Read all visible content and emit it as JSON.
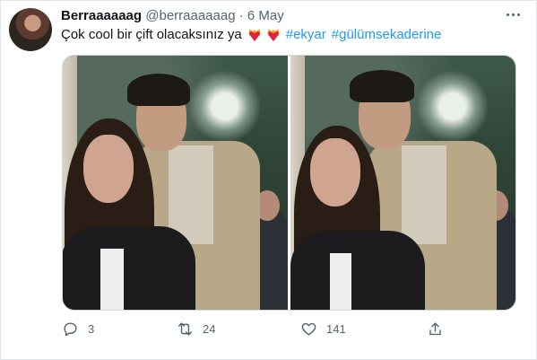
{
  "tweet": {
    "display_name": "Berraaaaaag",
    "handle": "@berraaaaaag",
    "separator": "·",
    "date": "6 May",
    "text": "Çok cool bir çift olacaksınız ya",
    "emoji_icon": "heart-on-fire-icon",
    "hashtags": [
      "#ekyar",
      "#gülümsekaderine"
    ]
  },
  "actions": {
    "reply_count": "3",
    "retweet_count": "24",
    "like_count": "141"
  },
  "colors": {
    "link": "#1d9bf0",
    "secondary_text": "#536471",
    "border": "#cfd9de"
  }
}
